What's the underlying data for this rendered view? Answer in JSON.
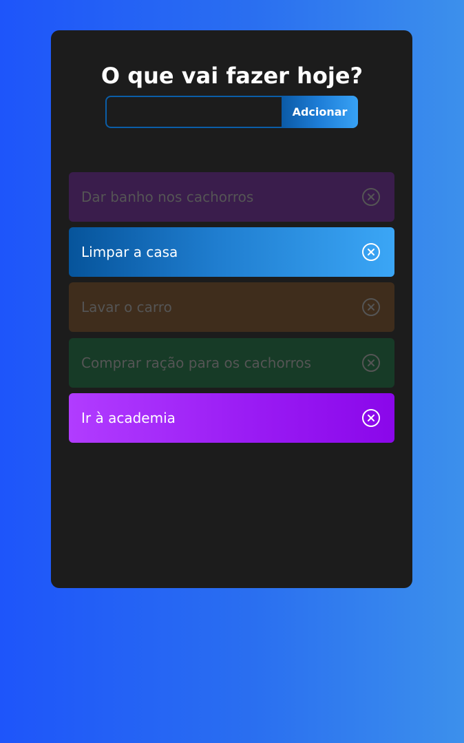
{
  "header": {
    "title": "O que vai fazer hoje?"
  },
  "form": {
    "input_value": "",
    "input_placeholder": "",
    "add_label": "Adcionar"
  },
  "todos": [
    {
      "label": "Dar banho nos cachorros",
      "state": "faded",
      "color": "#3a1d4c"
    },
    {
      "label": "Limpar a casa",
      "state": "active",
      "color": "#1f7dcf"
    },
    {
      "label": "Lavar o carro",
      "state": "faded",
      "color": "#3f2d1c"
    },
    {
      "label": "Comprar ração para os cachorros",
      "state": "faded",
      "color": "#173b27"
    },
    {
      "label": "Ir à academia",
      "state": "active",
      "color": "#9a1cf4"
    }
  ],
  "icons": {
    "remove": "close-circle-icon"
  },
  "colors": {
    "background_start": "#1e55fa",
    "background_end": "#3c90ec",
    "card": "#1c1c1c"
  }
}
